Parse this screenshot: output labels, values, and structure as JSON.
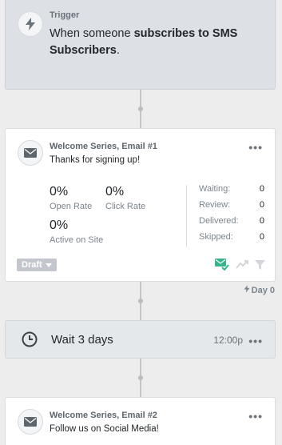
{
  "trigger": {
    "label": "Trigger",
    "text_prefix": "When someone ",
    "text_bold": "subscribes to SMS Subscribers",
    "text_suffix": ".",
    "icon": "lightning-icon"
  },
  "email1": {
    "title": "Welcome Series, Email #1",
    "subject": "Thanks for signing up!",
    "more_label": "•••",
    "stats": {
      "open_rate_value": "0%",
      "open_rate_label": "Open Rate",
      "click_rate_value": "0%",
      "click_rate_label": "Click Rate",
      "active_value": "0%",
      "active_label": "Active on Site"
    },
    "status": [
      {
        "label": "Waiting:",
        "value": "0"
      },
      {
        "label": "Review:",
        "value": "0"
      },
      {
        "label": "Delivered:",
        "value": "0"
      },
      {
        "label": "Skipped:",
        "value": "0"
      }
    ],
    "draft_label": "Draft",
    "icon": "envelope-icon"
  },
  "day_marker": {
    "label": "Day 0",
    "icon": "lightning-icon"
  },
  "wait": {
    "text": "Wait 3 days",
    "time": "12:00p",
    "more_label": "•••",
    "icon": "clock-icon"
  },
  "email2": {
    "title": "Welcome Series, Email #2",
    "subject": "Follow us on Social Media!",
    "more_label": "•••",
    "icon": "envelope-icon"
  },
  "colors": {
    "trigger_bg": "#dde0e5",
    "card_bg": "#ffffff",
    "wait_bg": "#e4e8ea",
    "draft_badge": "#c3c7cd",
    "success_green": "#35b58a"
  }
}
